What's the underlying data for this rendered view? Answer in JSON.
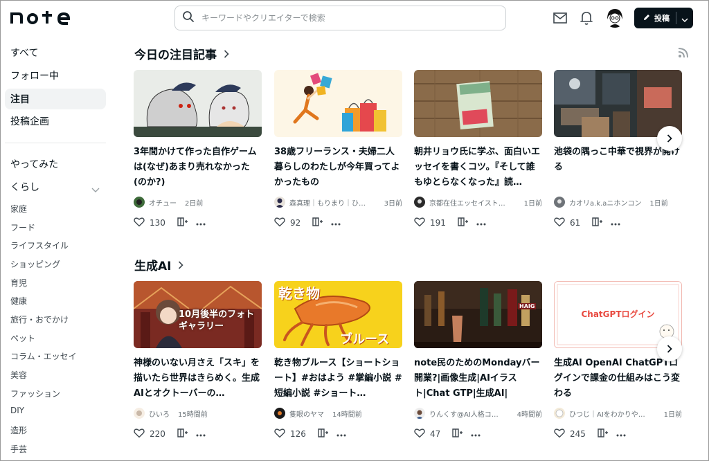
{
  "brand": {
    "logo_text": "note"
  },
  "search": {
    "placeholder": "キーワードやクリエイターで検索"
  },
  "header": {
    "post_label": "投稿"
  },
  "sidebar": {
    "top_items": [
      "すべて",
      "フォロー中",
      "注目",
      "投稿企画"
    ],
    "active_index": 2,
    "section_title": "やってみた",
    "category": "くらし",
    "sub_items": [
      "家庭",
      "フード",
      "ライフスタイル",
      "ショッピング",
      "育児",
      "健康",
      "旅行・おでかけ",
      "ペット",
      "コラム・エッセイ",
      "美容",
      "ファッション",
      "DIY",
      "造形",
      "手芸"
    ]
  },
  "sections": [
    {
      "title": "今日の注目記事",
      "cards": [
        {
          "title": "3年間かけて作った自作ゲームは(なぜ)あまり売れなかった(のか?)",
          "author": "オチュー",
          "time": "2日前",
          "likes": "130"
        },
        {
          "title": "38歳フリーランス・夫婦二人暮らしのわたしが今年買ってよかったもの",
          "author": "森真理｜もりまり｜ひ…",
          "time": "3日前",
          "likes": "92"
        },
        {
          "title": "朝井リョウ氏に学ぶ、面白いエッセイを書くコツ。『そして誰もゆとらなくなった』読…",
          "author": "京都在住エッセイスト…",
          "time": "1日前",
          "likes": "191"
        },
        {
          "title": "池袋の隅っこ中華で視界が開ける",
          "author": "カオリa.k.aニホンコン",
          "time": "1日前",
          "likes": "61"
        }
      ]
    },
    {
      "title": "生成AI",
      "cards": [
        {
          "title": "神様のいない月さえ「スキ」を描いたら世界はきらめく。生成AIとオクトーバーの…",
          "author": "ひいろ",
          "time": "15時間前",
          "likes": "220",
          "thumb_text": "10月後半のフォトギャラリー"
        },
        {
          "title": "乾き物ブルース【ショートショート】#おはよう #掌編小説 #短編小説 #ショート…",
          "author": "隻眼のヤマ",
          "time": "14時間前",
          "likes": "126",
          "thumb_text_top": "乾き物",
          "thumb_text_bottom": "ブルース"
        },
        {
          "title": "note民のためのMondayバー開業?|画像生成|AIイラスト|Chat GTP|生成AI|",
          "author": "りんくす@AI人格コ…",
          "time": "4時間前",
          "likes": "47",
          "thumb_text": "HAIG"
        },
        {
          "title": "生成AI OpenAI ChatGPTログインで課金の仕組みはこう変わる",
          "author": "ひつじ｜AIをわかりや…",
          "time": "1日前",
          "likes": "245",
          "thumb_text": "ChatGPTログイン"
        }
      ]
    }
  ],
  "colors": {
    "ink": "#08131a",
    "accent_red": "#e8493f",
    "thumb_bg_yellow": "#f7d21c"
  },
  "icons": [
    "search-icon",
    "mail-icon",
    "bell-icon",
    "pencil-icon",
    "chevron-down-icon",
    "chevron-right-icon",
    "rss-icon",
    "heart-icon",
    "magazine-icon",
    "more-icon"
  ]
}
